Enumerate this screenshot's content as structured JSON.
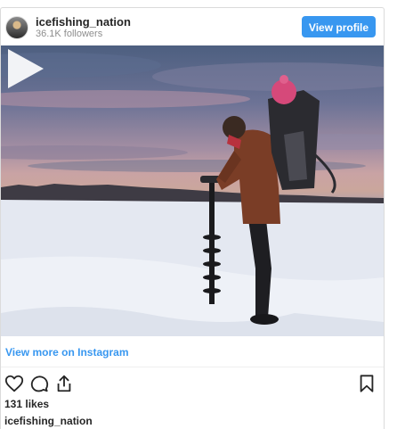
{
  "header": {
    "username": "icefishing_nation",
    "followers": "36.1K followers",
    "view_profile_label": "View profile"
  },
  "media": {
    "type": "video",
    "play_icon": "play-icon"
  },
  "footer": {
    "view_more_label": "View more on Instagram",
    "likes": "131 likes",
    "caption_username": "icefishing_nation"
  },
  "icons": [
    "heart-icon",
    "comment-icon",
    "share-icon",
    "bookmark-icon"
  ],
  "colors": {
    "accent": "#3897f0",
    "text": "#262626",
    "muted": "#8e8e8e",
    "border": "#dbdbdb"
  }
}
